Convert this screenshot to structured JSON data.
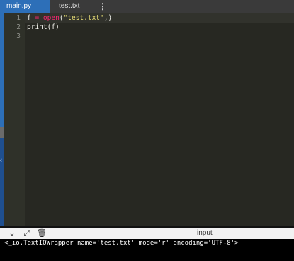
{
  "tabs": [
    {
      "label": "main.py",
      "active": true
    },
    {
      "label": "test.txt",
      "active": false
    }
  ],
  "editor": {
    "line_numbers": [
      "1",
      "2",
      "3"
    ],
    "lines": [
      {
        "parts": [
          "f",
          " = ",
          "open",
          "(",
          "\"test.txt\"",
          ",)"
        ]
      },
      {
        "parts": [
          "print",
          "(f)"
        ]
      },
      {
        "parts": []
      }
    ]
  },
  "toolbar": {
    "icons": [
      "chevron-down-icon",
      "expand-icon",
      "clear-icon"
    ],
    "input_label": "input"
  },
  "console": {
    "output": "<_io.TextIOWrapper name='test.txt' mode='r' encoding='UTF-8'>"
  },
  "colors": {
    "accent": "#2d6fb8",
    "editor_bg": "#272822",
    "keyword": "#f92672",
    "string": "#e6db74"
  }
}
